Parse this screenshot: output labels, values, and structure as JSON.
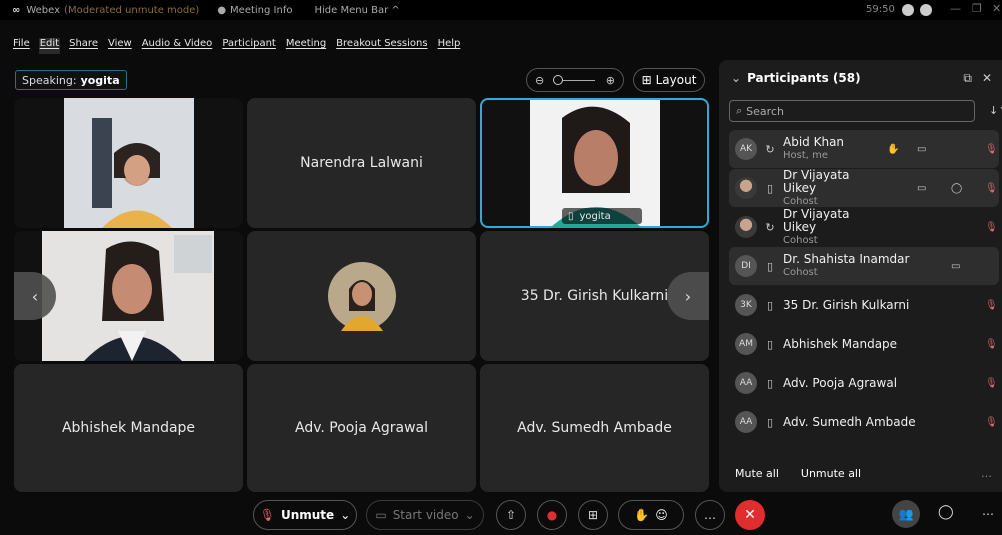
{
  "titlebar": {
    "app": "Webex",
    "mode": "(Moderated unmute mode)",
    "meeting_info": "Meeting Info",
    "hide_menu": "Hide Menu Bar ^",
    "timer": "59:50"
  },
  "menu": [
    "File",
    "Edit",
    "Share",
    "View",
    "Audio & Video",
    "Participant",
    "Meeting",
    "Breakout Sessions",
    "Help"
  ],
  "speaking": {
    "label": "Speaking:",
    "name": "yogita"
  },
  "layout_label": "Layout",
  "tiles": [
    {
      "name": "",
      "active": false
    },
    {
      "name": "Narendra Lalwani",
      "active": false
    },
    {
      "name": "yogita",
      "active": true
    },
    {
      "name": "",
      "active": false
    },
    {
      "name": "",
      "active": false
    },
    {
      "name": "35 Dr. Girish Kulkarni",
      "active": false
    },
    {
      "name": "Abhishek Mandape",
      "active": false
    },
    {
      "name": "Adv. Pooja Agrawal",
      "active": false
    },
    {
      "name": "Adv. Sumedh Ambade",
      "active": false
    }
  ],
  "panel": {
    "title": "Participants (58)",
    "search_placeholder": "Search",
    "participants": [
      {
        "initials": "AK",
        "name": "Abid Khan",
        "role": "Host, me",
        "highlight": true
      },
      {
        "initials": "",
        "name": "Dr Vijayata Uikey",
        "role": "Cohost",
        "highlight": true
      },
      {
        "initials": "",
        "name": "Dr Vijayata Uikey",
        "role": "Cohost",
        "highlight": false
      },
      {
        "initials": "DI",
        "name": "Dr. Shahista Inamdar",
        "role": "Cohost",
        "highlight": true
      },
      {
        "initials": "3K",
        "name": "35 Dr. Girish Kulkarni",
        "role": "",
        "highlight": false
      },
      {
        "initials": "AM",
        "name": "Abhishek Mandape",
        "role": "",
        "highlight": false
      },
      {
        "initials": "AA",
        "name": "Adv. Pooja Agrawal",
        "role": "",
        "highlight": false
      },
      {
        "initials": "AA",
        "name": "Adv. Sumedh Ambade",
        "role": "",
        "highlight": false
      }
    ],
    "mute_all": "Mute all",
    "unmute_all": "Unmute all"
  },
  "toolbar": {
    "unmute": "Unmute",
    "start_video": "Start video"
  }
}
